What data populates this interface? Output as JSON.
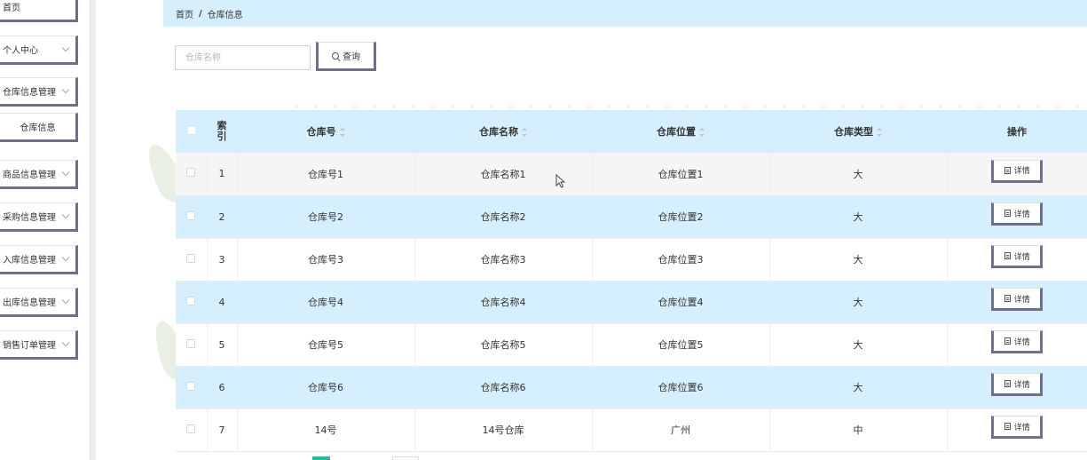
{
  "sidebar": {
    "items": [
      {
        "label": "首页",
        "expandable": false
      },
      {
        "label": "个人中心",
        "expandable": true
      },
      {
        "label": "仓库信息管理",
        "expandable": true
      },
      {
        "label": "仓库信息",
        "expandable": false,
        "sub": true
      },
      {
        "label": "商品信息管理",
        "expandable": true
      },
      {
        "label": "采购信息管理",
        "expandable": true
      },
      {
        "label": "入库信息管理",
        "expandable": true
      },
      {
        "label": "出库信息管理",
        "expandable": true
      },
      {
        "label": "销售订单管理",
        "expandable": true
      }
    ]
  },
  "breadcrumb": {
    "home": "首页",
    "separator": "/",
    "current": "仓库信息"
  },
  "search": {
    "placeholder": "仓库名称",
    "value": "",
    "button_label": "查询"
  },
  "table": {
    "headers": {
      "index_line1": "索",
      "index_line2": "引",
      "warehouse_no": "仓库号",
      "warehouse_name": "仓库名称",
      "warehouse_location": "仓库位置",
      "warehouse_type": "仓库类型",
      "actions": "操作"
    },
    "detail_label": "详情",
    "rows": [
      {
        "index": "1",
        "no": "仓库号1",
        "name": "仓库名称1",
        "location": "仓库位置1",
        "type": "大"
      },
      {
        "index": "2",
        "no": "仓库号2",
        "name": "仓库名称2",
        "location": "仓库位置2",
        "type": "大"
      },
      {
        "index": "3",
        "no": "仓库号3",
        "name": "仓库名称3",
        "location": "仓库位置3",
        "type": "大"
      },
      {
        "index": "4",
        "no": "仓库号4",
        "name": "仓库名称4",
        "location": "仓库位置4",
        "type": "大"
      },
      {
        "index": "5",
        "no": "仓库号5",
        "name": "仓库名称5",
        "location": "仓库位置5",
        "type": "大"
      },
      {
        "index": "6",
        "no": "仓库号6",
        "name": "仓库名称6",
        "location": "仓库位置6",
        "type": "大"
      },
      {
        "index": "7",
        "no": "14号",
        "name": "14号仓库",
        "location": "广州",
        "type": "中"
      }
    ]
  },
  "colors": {
    "accent_light_blue": "#d6efff",
    "button_border": "#6e6e8e",
    "pagination_active": "#2db7a0"
  }
}
